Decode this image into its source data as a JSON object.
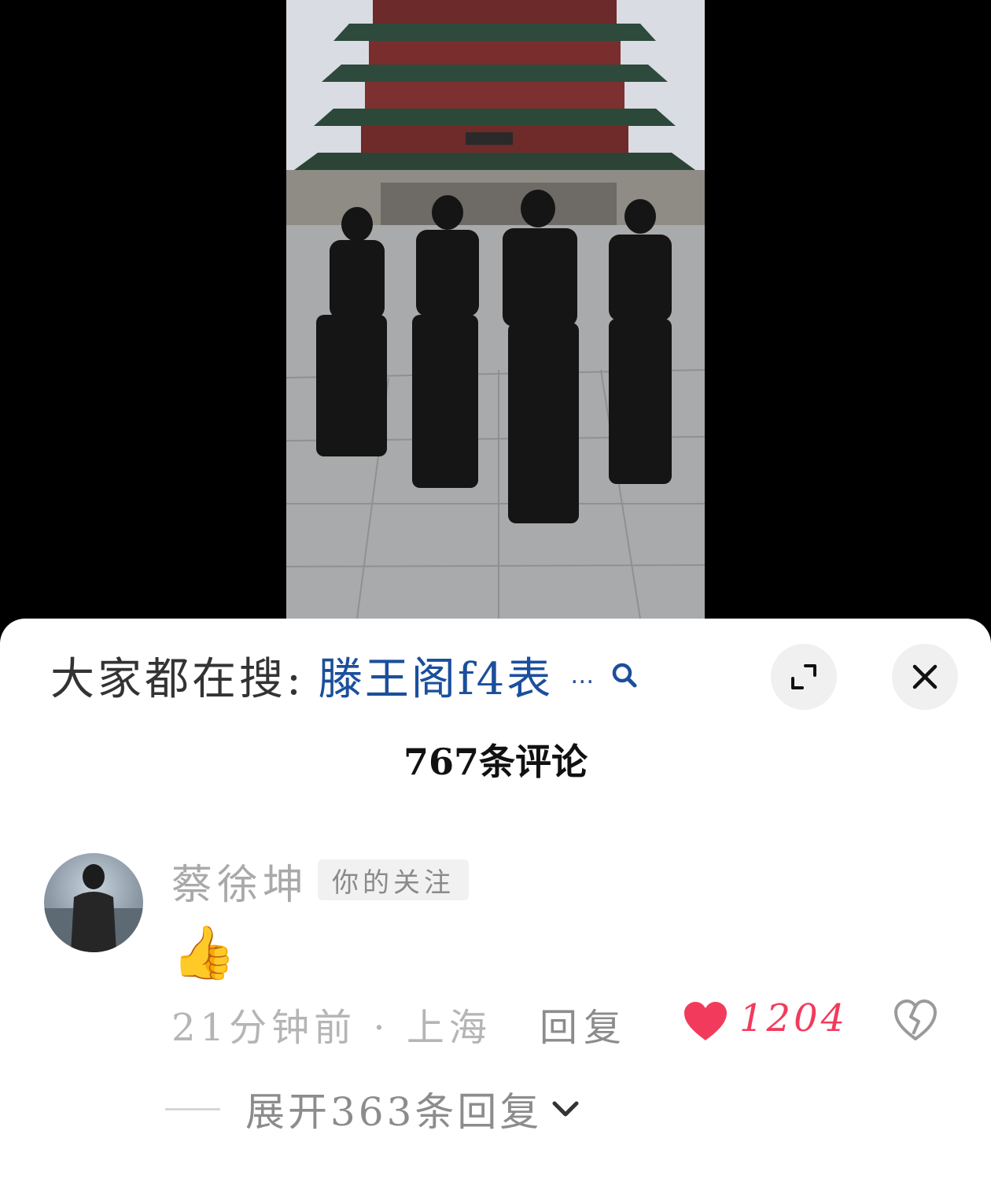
{
  "search": {
    "prefix": "大家都在搜:",
    "term": "滕王阁f4表",
    "ellipsis": "…"
  },
  "comments_header": {
    "count_label": "767条评论"
  },
  "comment": {
    "username": "蔡徐坤",
    "badge": "你的关注",
    "text": "👍",
    "time_location": "21分钟前 · 上海",
    "reply_label": "回复",
    "like_count": "1204",
    "expand_replies": "展开363条回复"
  },
  "colors": {
    "like": "#f23b5c",
    "search_term": "#1b4f9c",
    "sheet_bg": "#ffffff"
  },
  "icons": [
    "search-icon",
    "expand-icon",
    "close-icon",
    "heart-icon",
    "broken-heart-icon",
    "chevron-down-icon"
  ]
}
